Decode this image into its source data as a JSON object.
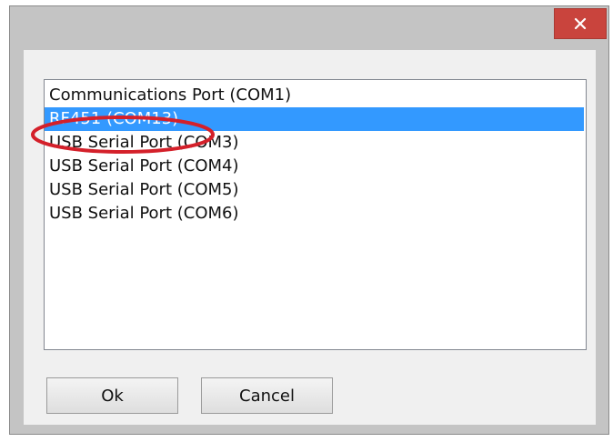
{
  "dialog": {
    "close_icon": "close-icon",
    "close_color": "#c9443d"
  },
  "list": {
    "items": [
      {
        "label": "Communications Port (COM1)"
      },
      {
        "label": "RF451 (COM13)",
        "selected": true
      },
      {
        "label": "USB Serial Port (COM3)"
      },
      {
        "label": "USB Serial Port (COM4)"
      },
      {
        "label": "USB Serial Port (COM5)"
      },
      {
        "label": "USB Serial Port (COM6)"
      }
    ],
    "selection_color": "#3399ff"
  },
  "annotation": {
    "color": "#d4202a"
  },
  "buttons": {
    "ok_label": "Ok",
    "cancel_label": "Cancel"
  }
}
